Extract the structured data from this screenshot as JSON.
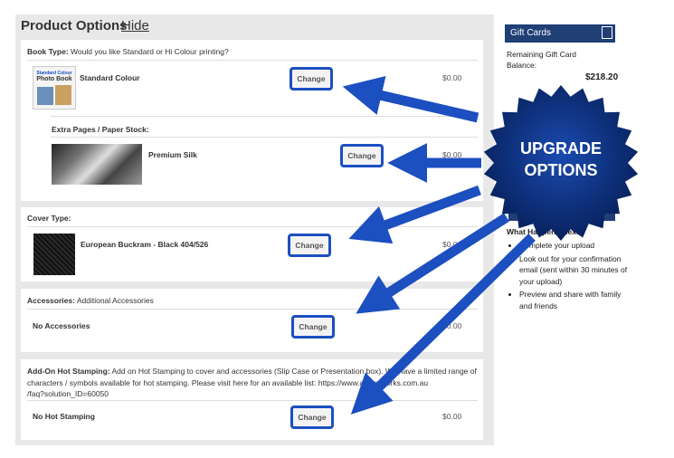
{
  "header": {
    "title": "Product Options",
    "hide_label": "Hide"
  },
  "book_type": {
    "label": "Book Type:",
    "description": "Would you like Standard or Hi Colour printing?",
    "thumb_text_1": "Standard Colour",
    "thumb_text_2": "Photo Book",
    "item": "Standard Colour",
    "change": "Change",
    "price": "$0.00"
  },
  "extra_pages": {
    "label": "Extra Pages / Paper Stock:",
    "item": "Premium Silk",
    "change": "Change",
    "price": "$0.00"
  },
  "cover_type": {
    "label": "Cover Type:",
    "item": "European Buckram - Black 404/526",
    "change": "Change",
    "price": "$0.00"
  },
  "accessories": {
    "label": "Accessories:",
    "description": "Additional Accessories",
    "item": "No Accessories",
    "change": "Change",
    "price": "$0.00"
  },
  "hot_stamping": {
    "label": "Add-On Hot Stamping:",
    "description_line1": "Add on Hot Stamping to cover and accessories (Slip Case or Presentation box). We have a limited range of",
    "description_line2": "characters / symbols available for hot stamping. Please visit here for an available list: https://www.albumworks.com.au",
    "description_line3": "/faq?solution_ID=60050",
    "item": "No Hot Stamping",
    "change": "Change",
    "price": "$0.00"
  },
  "sidebar": {
    "gift_cards_title": "Gift Cards",
    "remaining_line1": "Remaining Gift Card",
    "remaining_line2": "Balance:",
    "balance": "$218.20",
    "what_next_title": "What Happens Next?",
    "steps": [
      "Complete your upload",
      "Look out for your confirmation email (sent within 30 minutes of your upload)",
      "Preview and share with family and friends"
    ]
  },
  "annotation": {
    "line1": "UPGRADE",
    "line2": "OPTIONS"
  },
  "colors": {
    "accent": "#1c4fc0",
    "badge": "#0a2a6e",
    "sidebar_header": "#1f3f75"
  }
}
